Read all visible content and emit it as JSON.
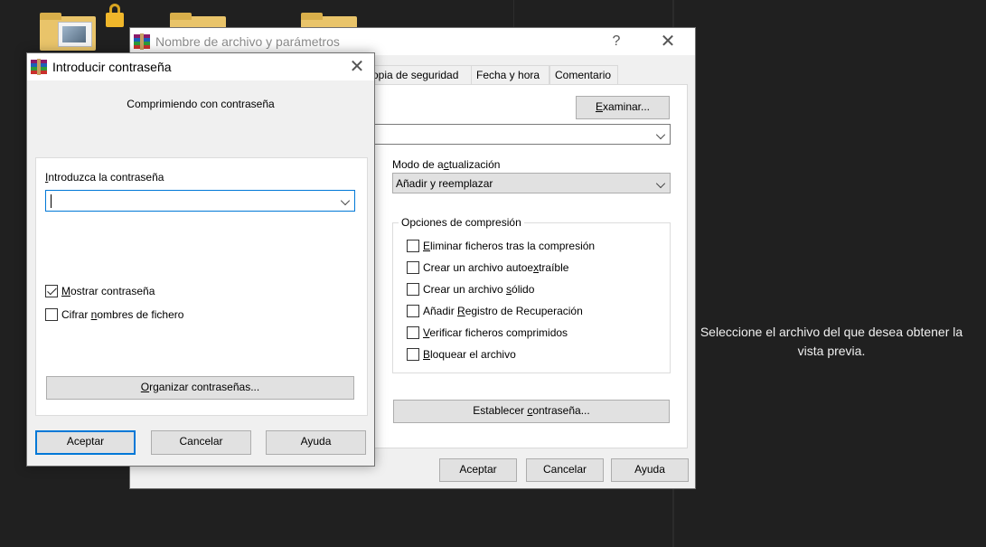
{
  "desktop": {
    "preview_message": "Seleccione el archivo del que desea obtener la vista previa."
  },
  "back_window": {
    "title": "Nombre de archivo y parámetros",
    "help_glyph": "?",
    "close_glyph": "✕",
    "tabs": [
      {
        "label": "opia de seguridad"
      },
      {
        "label": "Fecha y hora"
      },
      {
        "label": "Comentario"
      }
    ],
    "browse_button": {
      "pre": "",
      "u": "E",
      "post": "xaminar..."
    },
    "update_mode": {
      "label_pre": "Modo de a",
      "label_u": "c",
      "label_post": "tualización",
      "value": "Añadir y reemplazar"
    },
    "compression_options": {
      "title": "Opciones de compresión",
      "items": [
        {
          "pre": "",
          "u": "E",
          "post": "liminar ficheros tras la compresión",
          "checked": false
        },
        {
          "pre": "Crear un archivo autoe",
          "u": "x",
          "post": "traíble",
          "checked": false
        },
        {
          "pre": "Crear un archivo ",
          "u": "s",
          "post": "ólido",
          "checked": false
        },
        {
          "pre": "Añadir ",
          "u": "R",
          "post": "egistro de Recuperación",
          "checked": false
        },
        {
          "pre": "",
          "u": "V",
          "post": "erificar ficheros comprimidos",
          "checked": false
        },
        {
          "pre": "",
          "u": "B",
          "post": "loquear el archivo",
          "checked": false
        }
      ]
    },
    "set_password_button": {
      "pre": "Establecer ",
      "u": "c",
      "post": "ontraseña..."
    },
    "buttons": {
      "accept": "Aceptar",
      "cancel": "Cancelar",
      "help": "Ayuda"
    }
  },
  "front_window": {
    "title": "Introducir contraseña",
    "close_glyph": "✕",
    "heading": "Comprimiendo con contraseña",
    "password_label": {
      "pre": "",
      "u": "I",
      "post": "ntroduzca la contraseña"
    },
    "password_value": "",
    "show_password": {
      "pre": "",
      "u": "M",
      "post": "ostrar contraseña",
      "checked": true
    },
    "encrypt_names": {
      "pre": "Cifrar ",
      "u": "n",
      "post": "ombres de fichero",
      "checked": false
    },
    "organize_button": {
      "pre": "",
      "u": "O",
      "post": "rganizar contraseñas..."
    },
    "buttons": {
      "accept": "Aceptar",
      "cancel": "Cancelar",
      "help": "Ayuda"
    }
  }
}
